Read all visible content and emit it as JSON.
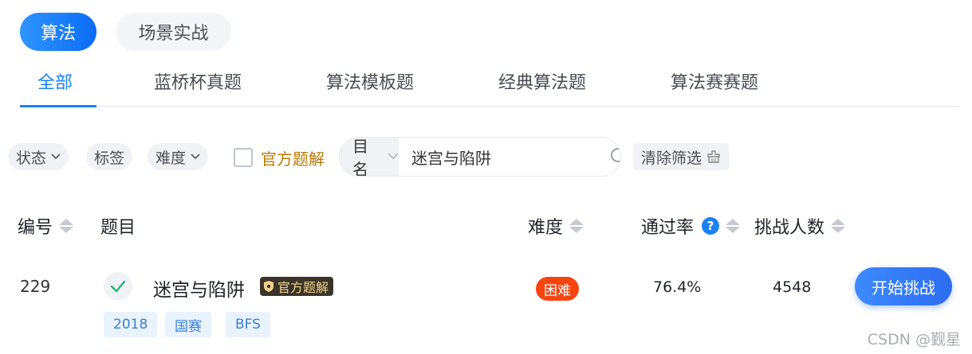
{
  "modes": [
    "算法",
    "场景实战"
  ],
  "categories": [
    "全部",
    "蓝桥杯真题",
    "算法模板题",
    "经典算法题",
    "算法赛赛题"
  ],
  "filters": {
    "status_label": "状态",
    "tags_label": "标签",
    "difficulty_label": "难度",
    "official_solution_label": "官方题解",
    "official_solution_checked": false,
    "search_type": "题目名称",
    "search_value": "迷宫与陷阱",
    "clear_label": "清除筛选"
  },
  "table": {
    "headers": {
      "id": "编号",
      "title": "题目",
      "difficulty": "难度",
      "pass_rate": "通过率",
      "pass_rate_help": "?",
      "challengers": "挑战人数"
    },
    "rows": [
      {
        "id": "229",
        "solved": true,
        "title": "迷宫与陷阱",
        "badge": "官方题解",
        "tags": [
          "2018",
          "国赛",
          "BFS"
        ],
        "difficulty": "困难",
        "pass_rate": "76.4%",
        "challengers": "4548",
        "action": "开始挑战"
      }
    ]
  },
  "watermark": "CSDN @觐星",
  "colors": {
    "accent": "#1a82f5",
    "difficulty_hard": "#f7440f",
    "success": "#22b573"
  }
}
